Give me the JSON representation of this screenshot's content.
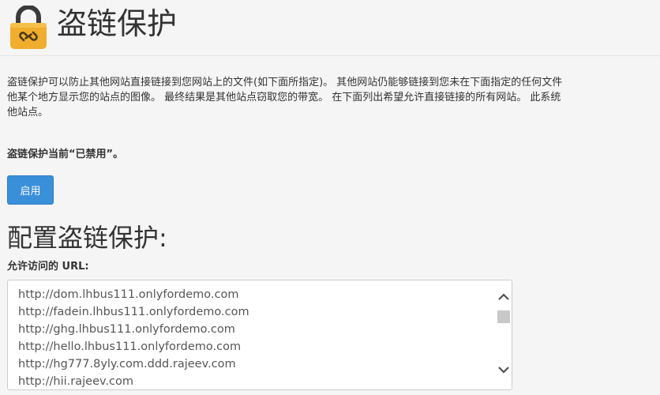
{
  "header": {
    "title": "盗链保护",
    "icon": "lock-link-icon",
    "icon_color": "#f0ad2e"
  },
  "description": {
    "lines": [
      "盗链保护可以防止其他网站直接链接到您网站上的文件(如下面所指定)。 其他网站仍能够链接到您未在下面指定的任何文件",
      "他某个地方显示您的站点的图像。 最终结果是其他站点窃取您的带宽。 在下面列出希望允许直接链接的所有网站。 此系统",
      "他站点。"
    ]
  },
  "status": {
    "text": "盗链保护当前“已禁用”。"
  },
  "actions": {
    "enable_label": "启用",
    "enable_color": "#3a8fd9"
  },
  "configure": {
    "heading": "配置盗链保护:",
    "url_label": "允许访问的 URL:",
    "urls": [
      "http://dom.lhbus111.onlyfordemo.com",
      "http://fadein.lhbus111.onlyfordemo.com",
      "http://ghg.lhbus111.onlyfordemo.com",
      "http://hello.lhbus111.onlyfordemo.com",
      "http://hg777.8yly.com.ddd.rajeev.com",
      "http://hii.rajeev.com"
    ]
  }
}
